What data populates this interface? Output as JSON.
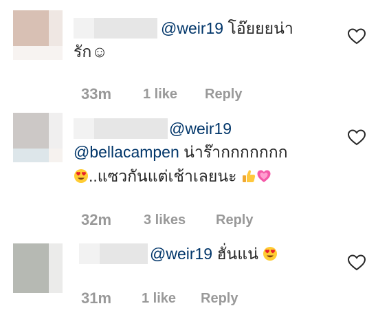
{
  "comments": [
    {
      "mention": "@weir19",
      "text_line1": " โอ๊ยยยน่า",
      "text_line2": "รัก☺",
      "time": "33m",
      "likes": "1 like",
      "reply": "Reply"
    },
    {
      "mention": "@weir19",
      "mention2": "@bellacampen",
      "text_line2": " น่าร๊ากกกกกกก",
      "text_line3": "..แซวกันแต่เช้าเลยนะ ",
      "time": "32m",
      "likes": "3 likes",
      "reply": "Reply"
    },
    {
      "mention": "@weir19",
      "text_line1": " ฮั่นแน่ ",
      "time": "31m",
      "likes": "1 like",
      "reply": "Reply"
    }
  ],
  "icons": {
    "like": "heart-outline-icon",
    "emoji_heart_eyes": "heart-eyes-emoji",
    "emoji_thumbs": "thumbs-up-emoji",
    "emoji_pink_heart": "sparkling-heart-emoji"
  },
  "colors": {
    "mention": "#003569",
    "meta": "#999999",
    "text": "#262626"
  }
}
